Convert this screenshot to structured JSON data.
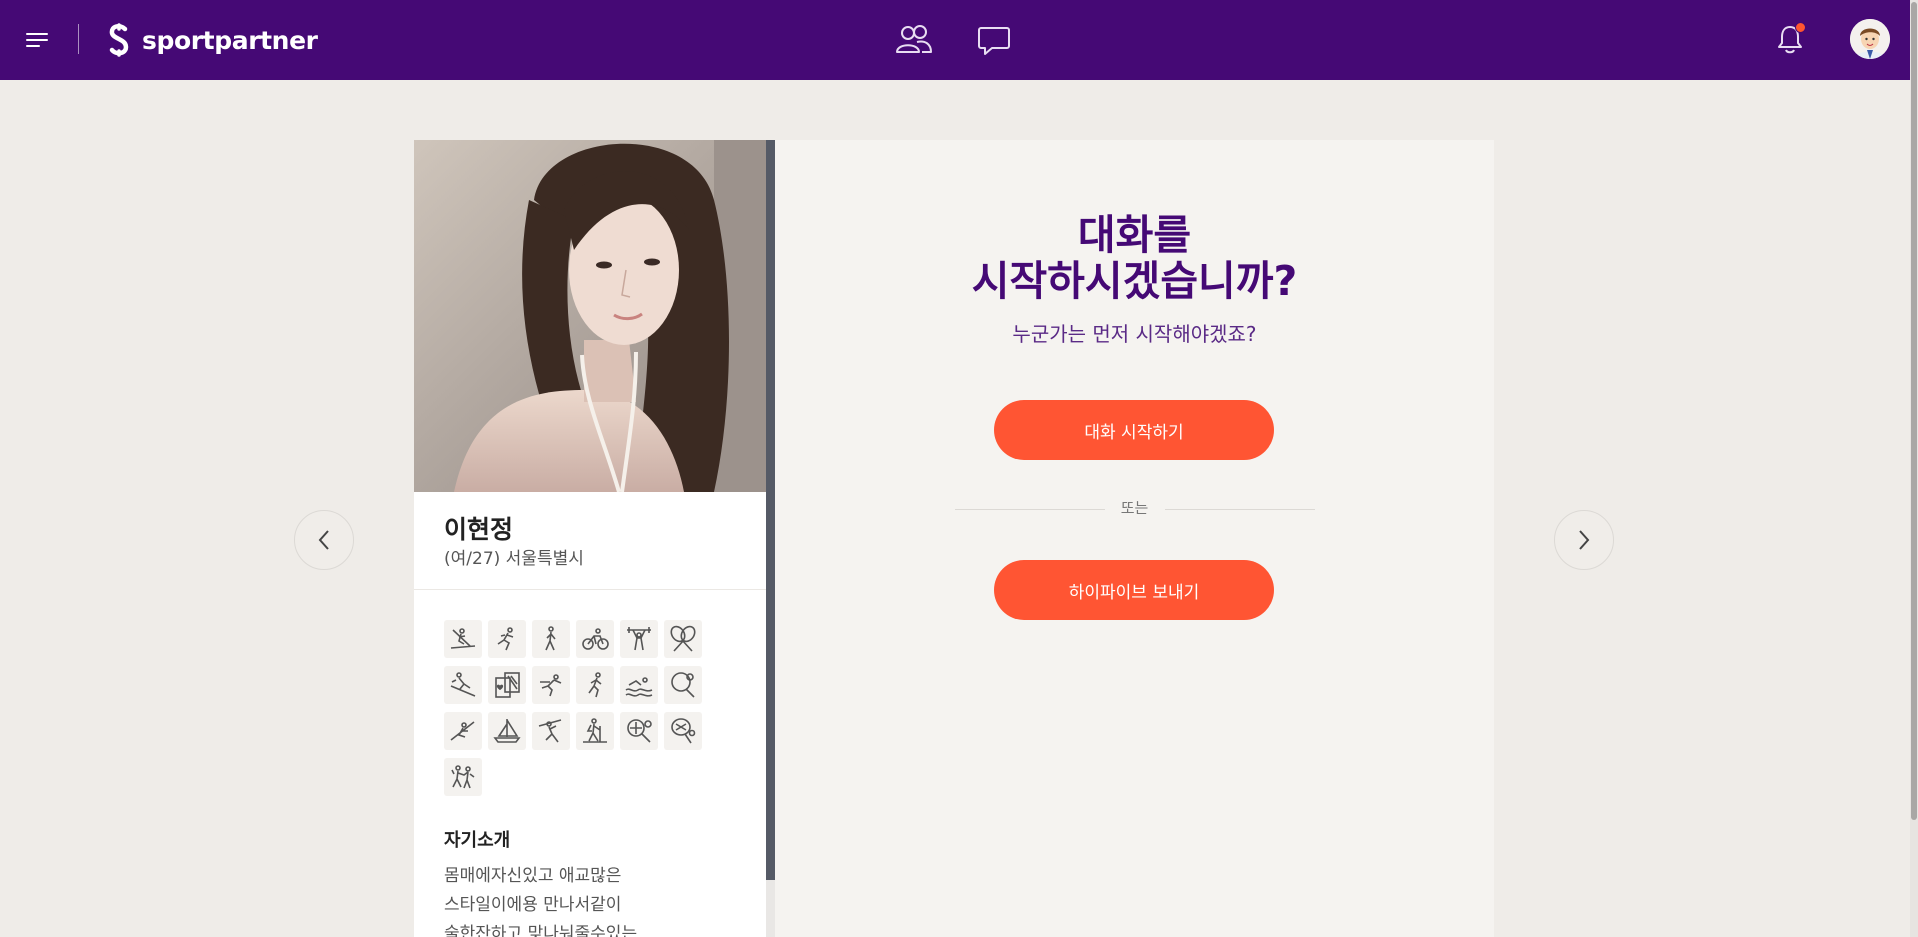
{
  "header": {
    "brand": "sportpartner",
    "has_notification": true
  },
  "profile": {
    "name": "이현정",
    "meta": "(여/27) 서울특별시",
    "sports_icons": [
      "treadmill-icon",
      "running-icon",
      "walking-icon",
      "cycling-icon",
      "weightlifting-icon",
      "badminton-icon",
      "skiing-icon",
      "cards-icon",
      "sprint-icon",
      "jogging-icon",
      "swimming-icon",
      "table-tennis-icon",
      "rowing-icon",
      "sailing-icon",
      "climbing-icon",
      "hiking-icon",
      "tennis-icon",
      "squash-icon",
      "dancing-icon"
    ],
    "intro_title": "자기소개",
    "intro_lines": [
      "몸매에자신있고 애교많은",
      "스타일이에용 만나서같이",
      "술한잔하고 맞나눠줄수있는"
    ]
  },
  "panel": {
    "title_line1": "대화를",
    "title_line2": "시작하시겠습니까?",
    "subtitle": "누군가는 먼저 시작해야겠죠?",
    "start_button": "대화 시작하기",
    "or_text": "또는",
    "hifive_button": "하이파이브 보내기"
  },
  "colors": {
    "header_bg": "#450975",
    "accent": "#ff5533",
    "title": "#450975"
  }
}
